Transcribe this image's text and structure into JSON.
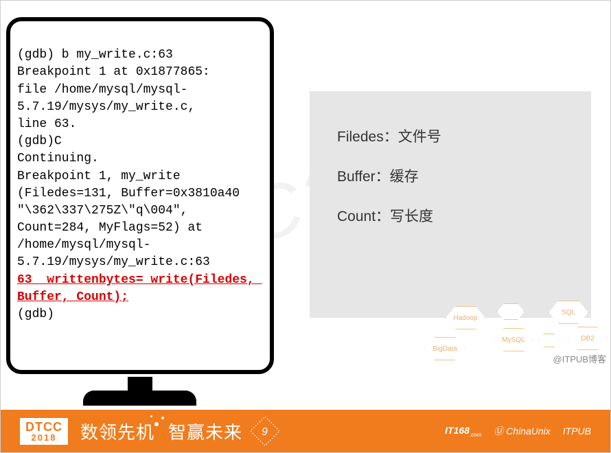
{
  "watermark": "DTCC2018",
  "terminal": {
    "lines": [
      "(gdb) b my_write.c:63",
      "Breakpoint 1 at 0x1877865:",
      "file /home/mysql/mysql-",
      "5.7.19/mysys/my_write.c,",
      "line 63.",
      "(gdb)C",
      "Continuing.",
      "Breakpoint 1, my_write",
      "(Filedes=131, Buffer=0x3810a40",
      "\"\\362\\337\\275Z\\\"q\\004\",",
      "Count=284, MyFlags=52) at",
      "/home/mysql/mysql-",
      "5.7.19/mysys/my_write.c:63"
    ],
    "highlight": "63  writtenbytes= write(Filedes, Buffer, Count);",
    "after": "(gdb)"
  },
  "info": {
    "r1": "Filedes：文件号",
    "r2": "Buffer：缓存",
    "r3": "Count：写长度"
  },
  "hex": {
    "h1": "Hadoop",
    "h2": "SQL",
    "h3": "MySQL",
    "h4": "DB2",
    "h5": "BigData"
  },
  "footer": {
    "logo_top": "DTCC",
    "logo_bottom": "2018",
    "slogan_a": "数领先机",
    "slogan_b": "智赢未来",
    "badge_number": "9",
    "sponsor1": "IT168",
    "sponsor2": "ChinaUnix",
    "sponsor3": "ITPUB"
  },
  "attribution": "@ITPUB博客"
}
